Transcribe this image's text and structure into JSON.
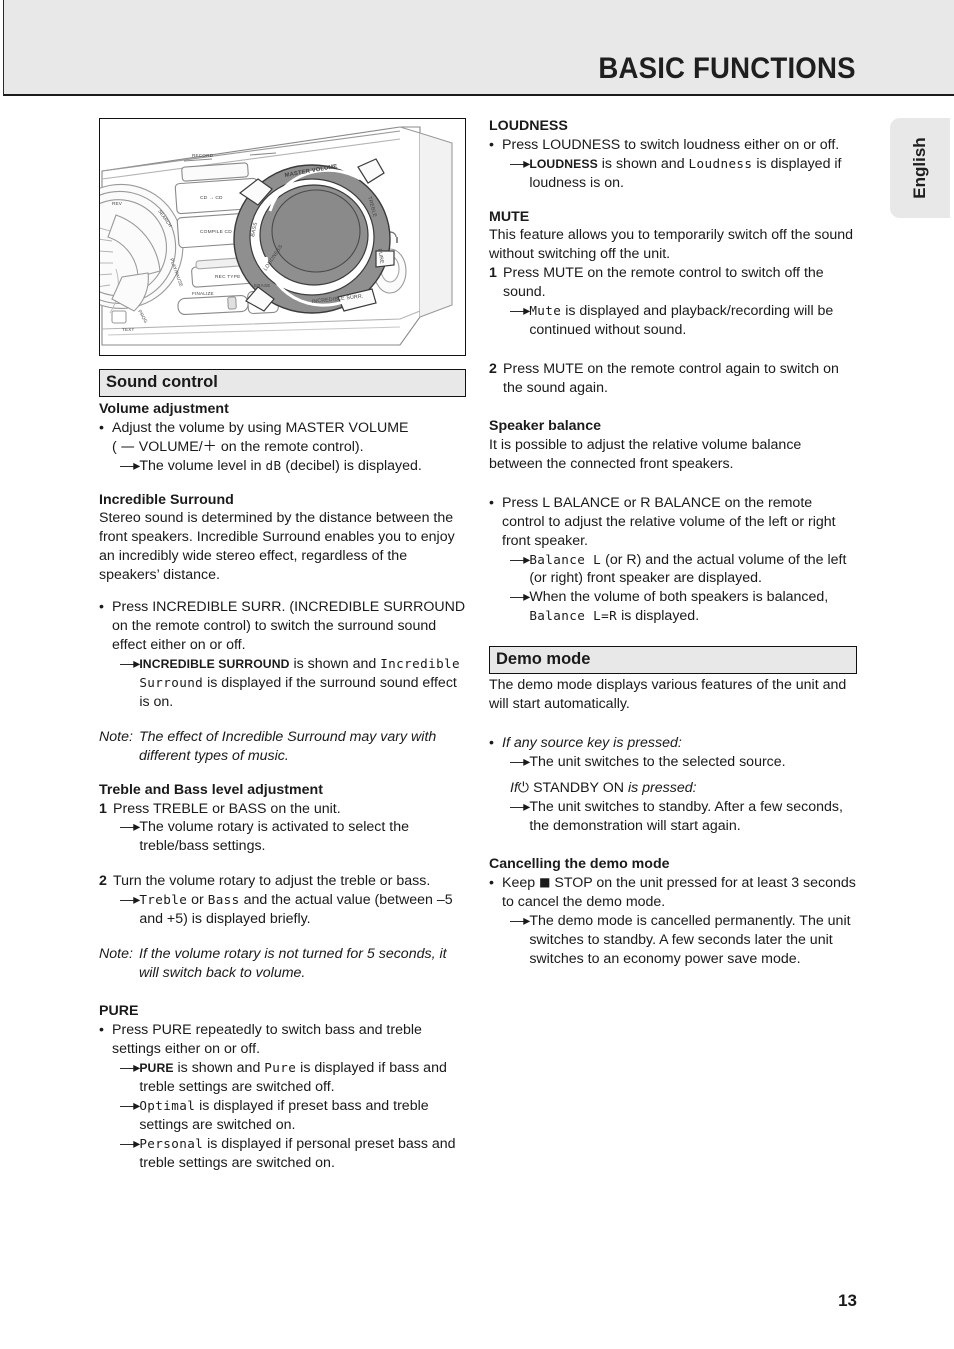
{
  "page": {
    "header_title": "BASIC FUNCTIONS",
    "language_tab": "English",
    "page_number": "13"
  },
  "illustration": {
    "caption_labels": [
      "RECORD",
      "CD → CD",
      "COMPILE CD",
      "SEARCH",
      "PLAY/PAUSE",
      "PROG",
      "REC TYPE",
      "FINALIZE",
      "ERASE",
      "TEXT",
      "MASTER VOLUME",
      "BASS",
      "TREBLE",
      "LOUDNESS",
      "PURE",
      "INCREDIBLE SURR."
    ]
  },
  "left_column": {
    "sound_control": {
      "bar_title": "Sound control",
      "volume": {
        "heading": "Volume adjustment",
        "bullet_line1": "Adjust the volume by using MASTER VOLUME",
        "bullet_line2_pre": "( ",
        "bullet_line2_minus": "—",
        "bullet_line2_mid": " VOLUME/",
        "bullet_line2_plus": "＋",
        "bullet_line2_post": " on the remote control).",
        "arrow_pre": "The volume level in ",
        "arrow_disp": "dB",
        "arrow_post": " (decibel) is displayed."
      },
      "incredible_surround": {
        "heading": "Incredible Surround",
        "paragraph": "Stereo sound is determined by the distance between the front speakers. Incredible Surround enables you to enjoy an incredibly wide stereo effect, regardless of the speakers’ distance.",
        "bullet": "Press INCREDIBLE SURR. (INCREDIBLE SURROUND on the remote control) to switch the surround sound effect either on or off.",
        "arrow_caps": "INCREDIBLE SURROUND",
        "arrow_mid": " is shown and ",
        "arrow_disp": "Incredible Surround",
        "arrow_post": " is displayed if the surround sound effect is on.",
        "note_label": "Note:",
        "note_text": "The effect of Incredible Surround may vary with different types of music."
      },
      "treble_bass": {
        "heading": "Treble and Bass level adjustment",
        "step1_num": "1",
        "step1_text": "Press TREBLE or BASS on the unit.",
        "step1_arrow": "The volume rotary is activated to select the treble/bass settings.",
        "step2_num": "2",
        "step2_text": "Turn the volume rotary to adjust the treble or bass.",
        "step2_arrow_disp1": "Treble",
        "step2_arrow_mid": " or ",
        "step2_arrow_disp2": "Bass",
        "step2_arrow_post": " and the actual value (between –5 and +5) is displayed briefly.",
        "note_label": "Note:",
        "note_text": "If the volume rotary is not turned for 5 seconds, it will switch back to volume."
      },
      "pure": {
        "heading": "PURE",
        "bullet": "Press PURE repeatedly to switch bass and treble settings either on or off.",
        "arrow1_caps": "PURE",
        "arrow1_mid": " is shown and ",
        "arrow1_disp": "Pure",
        "arrow1_post": " is displayed if bass and treble settings are switched off.",
        "arrow2_disp": "Optimal",
        "arrow2_post": " is displayed if preset bass and treble settings are switched on.",
        "arrow3_disp": "Personal",
        "arrow3_post": " is displayed if personal preset bass and treble settings are switched on."
      }
    }
  },
  "right_column": {
    "loudness": {
      "heading": "LOUDNESS",
      "bullet": "Press LOUDNESS to switch loudness either on or off.",
      "arrow_caps": "LOUDNESS",
      "arrow_mid": " is shown and ",
      "arrow_disp": "Loudness",
      "arrow_post": " is displayed if loudness is on."
    },
    "mute": {
      "heading": "MUTE",
      "paragraph": "This feature allows you to temporarily switch off the sound without switching off the unit.",
      "step1_num": "1",
      "step1_text": "Press MUTE on the remote control to switch off the sound.",
      "step1_arrow_disp": "Mute",
      "step1_arrow_post": " is displayed and playback/recording will be continued without sound.",
      "step2_num": "2",
      "step2_text": "Press MUTE on the remote control again to switch on the sound again."
    },
    "speaker_balance": {
      "heading": "Speaker balance",
      "paragraph": "It is possible to adjust the relative volume balance between the connected front speakers.",
      "bullet": "Press L BALANCE or R BALANCE on the remote control to adjust the relative volume of the left or right front speaker.",
      "arrow1_disp": "Balance  L",
      "arrow1_post": " (or R) and the actual volume of the left (or right) front speaker are displayed.",
      "arrow2_pre": "When the volume of both speakers is balanced,",
      "arrow2_disp": "Balance  L=R",
      "arrow2_post": " is displayed."
    },
    "demo_mode": {
      "bar_title": "Demo mode",
      "paragraph": "The demo mode displays various features of the unit and will start automatically.",
      "bullet_italic": "If any source key is pressed:",
      "arrow1": "The unit switches to the selected source.",
      "standby_pre": "If",
      "standby_symbol": "⏻",
      "standby_caps": " STANDBY ON ",
      "standby_post": "is pressed:",
      "arrow2": "The unit switches to standby. After a few seconds, the demonstration will start again.",
      "cancel_heading": "Cancelling the demo mode",
      "cancel_bullet_pre": "Keep ",
      "cancel_bullet_sym": "■",
      "cancel_bullet_post": "  STOP on the unit pressed for at least 3 seconds to cancel the demo mode.",
      "cancel_arrow": "The demo mode is cancelled permanently. The unit switches to standby. A few seconds later the unit switches to an economy power save mode."
    }
  },
  "colors": {
    "header_band": "#e8e8e8",
    "rule": "#1a1a1a",
    "text": "#1a1a1a"
  }
}
